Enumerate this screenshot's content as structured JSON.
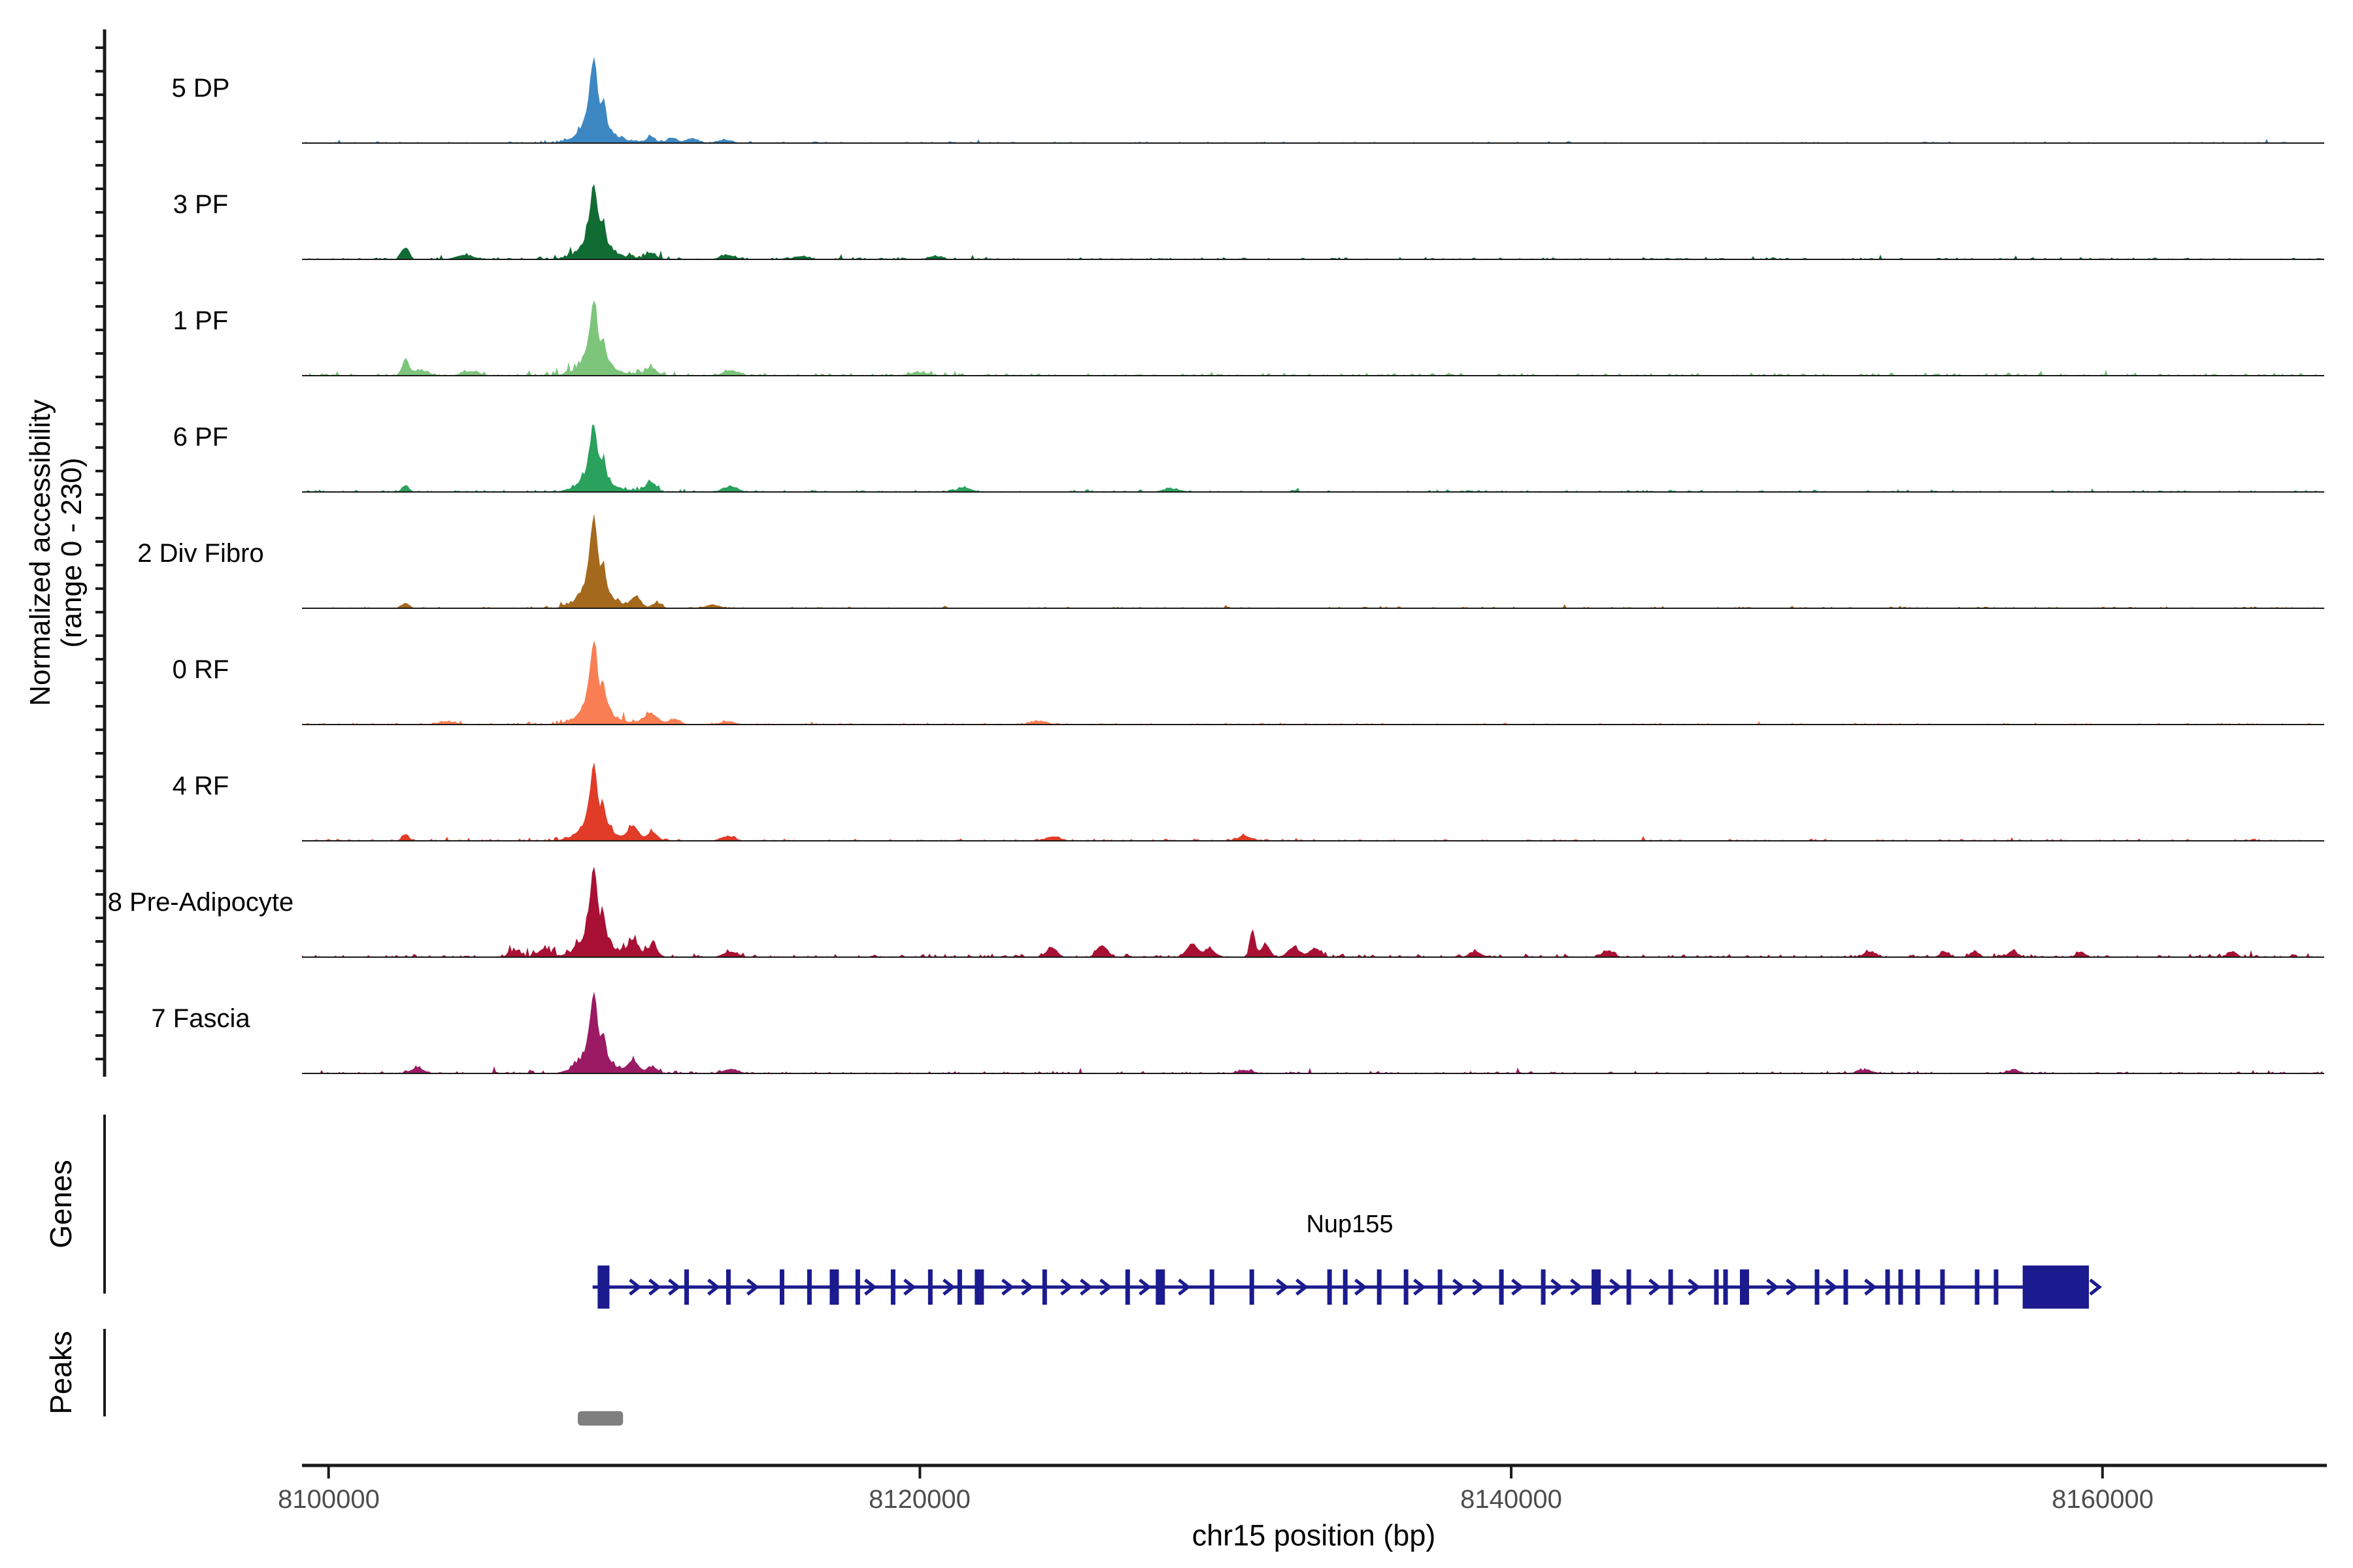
{
  "figure": {
    "y_axis_title_line1": "Normalized accessibility",
    "y_axis_title_line2": "(range 0 - 230)",
    "genes_panel_label": "Genes",
    "peaks_panel_label": "Peaks",
    "x_axis_title": "chr15 position (bp)",
    "x_tick_labels": [
      "8100000",
      "8120000",
      "8140000",
      "8160000"
    ]
  },
  "chart_data": {
    "type": "area",
    "title": "",
    "xlabel": "chr15 position (bp)",
    "ylabel": "Normalized accessibility (range 0 - 230)",
    "y_range": [
      0,
      230
    ],
    "grid": false,
    "legend_position": "none",
    "region": {
      "chrom": "chr15",
      "start": 8099100,
      "end": 8167500
    },
    "x_ticks": [
      8100000,
      8120000,
      8140000,
      8160000
    ],
    "promoter_apex_bp": 8108980,
    "promoter_peak_shape": [
      [
        -900,
        200,
        0.05
      ],
      [
        -420,
        170,
        0.16
      ],
      [
        -165,
        105,
        0.5
      ],
      [
        0,
        90,
        1.0
      ],
      [
        90,
        150,
        0.52
      ],
      [
        320,
        70,
        0.48
      ],
      [
        470,
        120,
        0.17
      ],
      [
        780,
        190,
        0.09
      ],
      [
        0,
        420,
        0.26
      ],
      [
        1300,
        220,
        0.05
      ]
    ],
    "tracks": [
      {
        "label": "5 DP",
        "color": "#3d87c2",
        "peak_height": 0.8,
        "noise": 0.012,
        "extra_peaks": [
          [
            8110900,
            150,
            0.06
          ],
          [
            8111600,
            160,
            0.05
          ],
          [
            8112300,
            220,
            0.04
          ],
          [
            8113400,
            250,
            0.03
          ]
        ]
      },
      {
        "label": "3 PF",
        "color": "#116c33",
        "peak_height": 0.7,
        "noise": 0.018,
        "extra_peaks": [
          [
            8102600,
            120,
            0.11
          ],
          [
            8104600,
            300,
            0.04
          ],
          [
            8110900,
            180,
            0.06
          ],
          [
            8113500,
            250,
            0.04
          ],
          [
            8116000,
            250,
            0.03
          ],
          [
            8120500,
            220,
            0.03
          ]
        ]
      },
      {
        "label": "1 PF",
        "color": "#7cc57b",
        "peak_height": 0.7,
        "noise": 0.022,
        "extra_peaks": [
          [
            8102600,
            110,
            0.15
          ],
          [
            8103100,
            260,
            0.05
          ],
          [
            8104800,
            300,
            0.04
          ],
          [
            8110900,
            200,
            0.07
          ],
          [
            8113600,
            250,
            0.05
          ],
          [
            8120000,
            300,
            0.03
          ]
        ]
      },
      {
        "label": "6 PF",
        "color": "#2aa15c",
        "peak_height": 0.62,
        "noise": 0.018,
        "extra_peaks": [
          [
            8102600,
            120,
            0.06
          ],
          [
            8110900,
            180,
            0.09
          ],
          [
            8113600,
            250,
            0.05
          ],
          [
            8121500,
            250,
            0.04
          ],
          [
            8128500,
            300,
            0.03
          ]
        ]
      },
      {
        "label": "2 Div Fibro",
        "color": "#a4691c",
        "peak_height": 0.86,
        "noise": 0.013,
        "extra_peaks": [
          [
            8102600,
            120,
            0.05
          ],
          [
            8110400,
            170,
            0.09
          ],
          [
            8111100,
            160,
            0.05
          ],
          [
            8113000,
            250,
            0.03
          ]
        ]
      },
      {
        "label": "0 RF",
        "color": "#f97e54",
        "peak_height": 0.78,
        "noise": 0.014,
        "extra_peaks": [
          [
            8104000,
            300,
            0.03
          ],
          [
            8110900,
            240,
            0.1
          ],
          [
            8111700,
            200,
            0.05
          ],
          [
            8113500,
            250,
            0.03
          ],
          [
            8124000,
            300,
            0.03
          ]
        ]
      },
      {
        "label": "4 RF",
        "color": "#e03c28",
        "peak_height": 0.7,
        "noise": 0.016,
        "extra_peaks": [
          [
            8102600,
            120,
            0.06
          ],
          [
            8110300,
            180,
            0.12
          ],
          [
            8110950,
            180,
            0.08
          ],
          [
            8113500,
            250,
            0.04
          ],
          [
            8124500,
            250,
            0.04
          ],
          [
            8131000,
            250,
            0.04
          ]
        ]
      },
      {
        "label": "8 Pre-Adipocyte",
        "color": "#a81134",
        "peak_height": 0.84,
        "noise": 0.026,
        "extra_peaks": [
          [
            8106300,
            200,
            0.06
          ],
          [
            8107300,
            200,
            0.08
          ],
          [
            8110300,
            180,
            0.14
          ],
          [
            8110950,
            180,
            0.1
          ],
          [
            8113600,
            250,
            0.05
          ],
          [
            8124460,
            180,
            0.09
          ],
          [
            8126160,
            180,
            0.11
          ],
          [
            8129215,
            200,
            0.12
          ],
          [
            8129810,
            160,
            0.08
          ],
          [
            8131250,
            90,
            0.26
          ],
          [
            8131690,
            150,
            0.12
          ],
          [
            8132640,
            200,
            0.09
          ],
          [
            8133370,
            200,
            0.08
          ],
          [
            8138790,
            200,
            0.05
          ],
          [
            8143270,
            200,
            0.06
          ],
          [
            8152115,
            200,
            0.05
          ],
          [
            8154658,
            150,
            0.05
          ],
          [
            8155675,
            150,
            0.05
          ],
          [
            8156958,
            150,
            0.06
          ],
          [
            8159258,
            150,
            0.05
          ],
          [
            8164367,
            150,
            0.05
          ]
        ]
      },
      {
        "label": "7 Fascia",
        "color": "#9a1a64",
        "peak_height": 0.76,
        "noise": 0.018,
        "extra_peaks": [
          [
            8103000,
            220,
            0.05
          ],
          [
            8110300,
            180,
            0.1
          ],
          [
            8110950,
            180,
            0.06
          ],
          [
            8113600,
            250,
            0.04
          ],
          [
            8131000,
            250,
            0.03
          ],
          [
            8152000,
            250,
            0.03
          ],
          [
            8157000,
            220,
            0.03
          ]
        ]
      }
    ],
    "gene_track": {
      "genes": [
        {
          "name": "Nup155",
          "strand": "+",
          "color": "#1b1b8f",
          "start": 8108930,
          "end": 8159540,
          "first_exon": [
            8109100,
            8109500
          ],
          "last_exon": [
            8157300,
            8159540
          ],
          "exons": [
            8112110,
            8113524,
            8115337,
            8116265,
            8117105,
            8117900,
            8119094,
            8120353,
            8121348,
            8122011,
            8124221,
            8127028,
            8128133,
            8129879,
            8131227,
            8133857,
            8134388,
            8135537,
            8136443,
            8137592,
            8139669,
            8141084,
            8142874,
            8143979,
            8145394,
            8146941,
            8147250,
            8147891,
            8150344,
            8151317,
            8152731,
            8153173,
            8153748,
            8154588,
            8155759,
            8156400
          ],
          "wide_exons": [
            8117105,
            8122011,
            8128133,
            8142874,
            8147891
          ]
        }
      ]
    },
    "peaks_track": {
      "color": "#7f7f7f",
      "regions": [
        [
          8108430,
          8109960
        ]
      ]
    }
  }
}
